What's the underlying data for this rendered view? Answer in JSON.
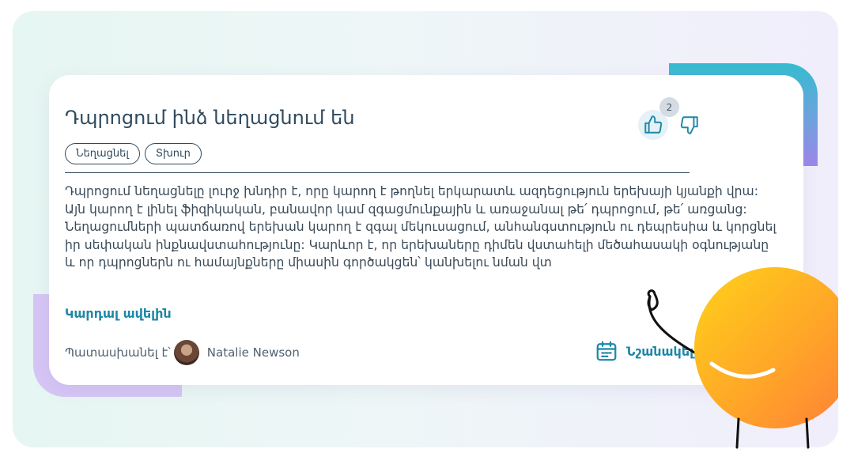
{
  "question": {
    "title": "Դպրոցում ինձ նեղացնում են",
    "tags": [
      "Նեղացնել",
      "Տխուր"
    ],
    "body": "Դպրոցում նեղացնելը լուրջ խնդիր է, որը կարող է թողնել երկարատև ազդեցություն երեխայի կյանքի վրա: Այն կարող է լինել ֆիզիկական, բանավոր կամ զգացմունքային և առաջանալ թե՛ դպրոցում, թե՛ առցանց: Նեղացումների պատճառով երեխան կարող է զգալ մեկուսացում, անհանգստություն ու դեպրեսիա և կորցնել իր սեփական ինքնավստահությունը: Կարևոր է, որ երեխաները դիմեն վստահելի մեծահասակի օգնությանը և որ դպրոցներն ու համայնքները միասին գործակցեն՝ կանխելու նման վտ",
    "read_more_label": "Կարդալ ավելին"
  },
  "reactions": {
    "like_count": "2",
    "like_icon": "thumbs-up-icon",
    "dislike_icon": "thumbs-down-icon"
  },
  "answer": {
    "answered_by_label": "Պատասխանել է՝",
    "answerer_name": "Natalie Newson"
  },
  "actions": {
    "mark_label": "Նշանակել",
    "mark_icon": "calendar-icon"
  },
  "colors": {
    "accent_text": "#1e87a8",
    "title_text": "#2f4a5e",
    "decor_teal": "#36bcd0",
    "decor_purple": "#d6c5f5",
    "mascot_yellow": "#ffc81a",
    "mascot_orange": "#ff8a35"
  }
}
